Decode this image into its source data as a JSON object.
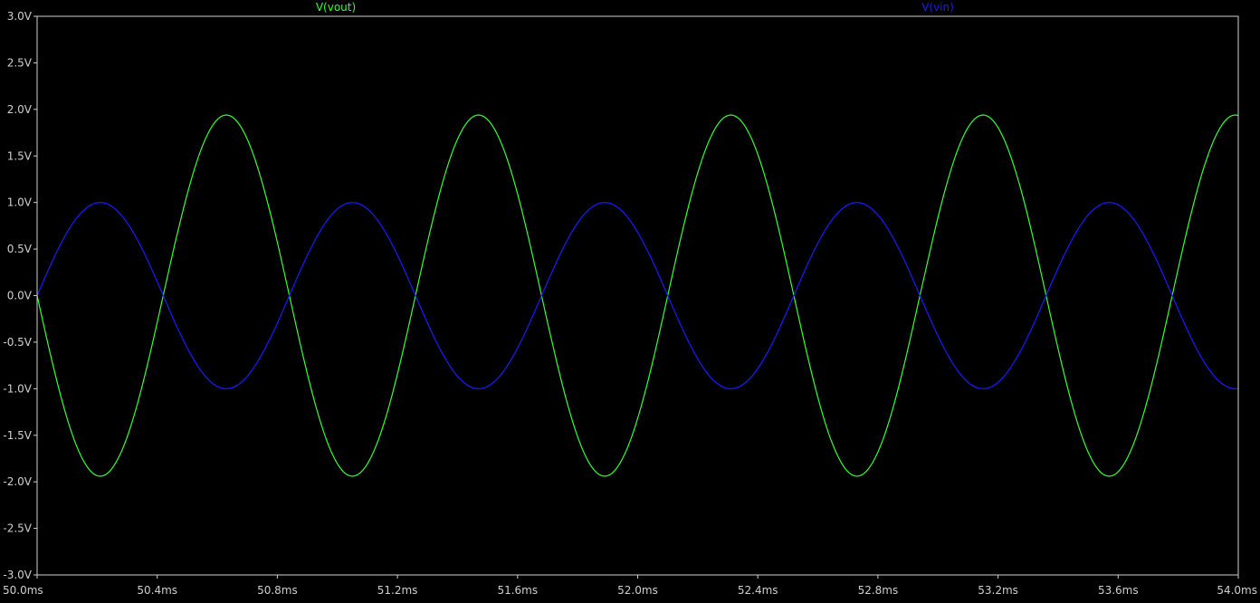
{
  "chart_data": {
    "type": "line",
    "title": "",
    "xlabel": "",
    "ylabel": "",
    "xlim": [
      50.0,
      54.0
    ],
    "ylim": [
      -3.0,
      3.0
    ],
    "grid": false,
    "x_ticks": [
      50.0,
      50.4,
      50.8,
      51.2,
      51.6,
      52.0,
      52.4,
      52.8,
      53.2,
      53.6,
      54.0
    ],
    "x_tick_labels": [
      "50.0ms",
      "50.4ms",
      "50.8ms",
      "51.2ms",
      "51.6ms",
      "52.0ms",
      "52.4ms",
      "52.8ms",
      "53.2ms",
      "53.6ms",
      "54.0ms"
    ],
    "y_ticks": [
      3.0,
      2.5,
      2.0,
      1.5,
      1.0,
      0.5,
      0.0,
      -0.5,
      -1.0,
      -1.5,
      -2.0,
      -2.5,
      -3.0
    ],
    "y_tick_labels": [
      "3.0V",
      "2.5V",
      "2.0V",
      "1.5V",
      "1.0V",
      "0.5V",
      "0.0V",
      "-0.5V",
      "-1.0V",
      "-1.5V",
      "-2.0V",
      "-2.5V",
      "-3.0V"
    ],
    "series": [
      {
        "name": "V(vout)",
        "color": "#33ff33",
        "x": [
          50.0,
          50.21,
          50.42,
          50.63,
          50.84,
          51.05,
          51.26,
          51.47,
          51.68,
          51.89,
          52.1,
          52.31,
          52.52,
          52.73,
          52.94,
          53.15,
          53.36,
          53.57,
          53.78,
          53.99
        ],
        "y": [
          0.0,
          -1.94,
          0.0,
          1.94,
          0.0,
          -1.94,
          0.0,
          1.94,
          0.0,
          -1.94,
          0.0,
          1.94,
          0.0,
          -1.94,
          0.0,
          1.94,
          0.0,
          -1.94,
          0.0,
          1.94
        ]
      },
      {
        "name": "V(vin)",
        "color": "#1a1aff",
        "x": [
          50.0,
          50.21,
          50.42,
          50.63,
          50.84,
          51.05,
          51.26,
          51.47,
          51.68,
          51.89,
          52.1,
          52.31,
          52.52,
          52.73,
          52.94,
          53.15,
          53.36,
          53.57,
          53.78,
          53.99
        ],
        "y": [
          0.0,
          1.0,
          0.0,
          -1.0,
          0.0,
          1.0,
          0.0,
          -1.0,
          0.0,
          1.0,
          0.0,
          -1.0,
          0.0,
          1.0,
          0.0,
          -1.0,
          0.0,
          1.0,
          0.0,
          -1.0
        ]
      }
    ]
  },
  "colors": {
    "background": "#000000",
    "axis": "#cfcfcf",
    "tick_text": "#cfcfcf"
  }
}
